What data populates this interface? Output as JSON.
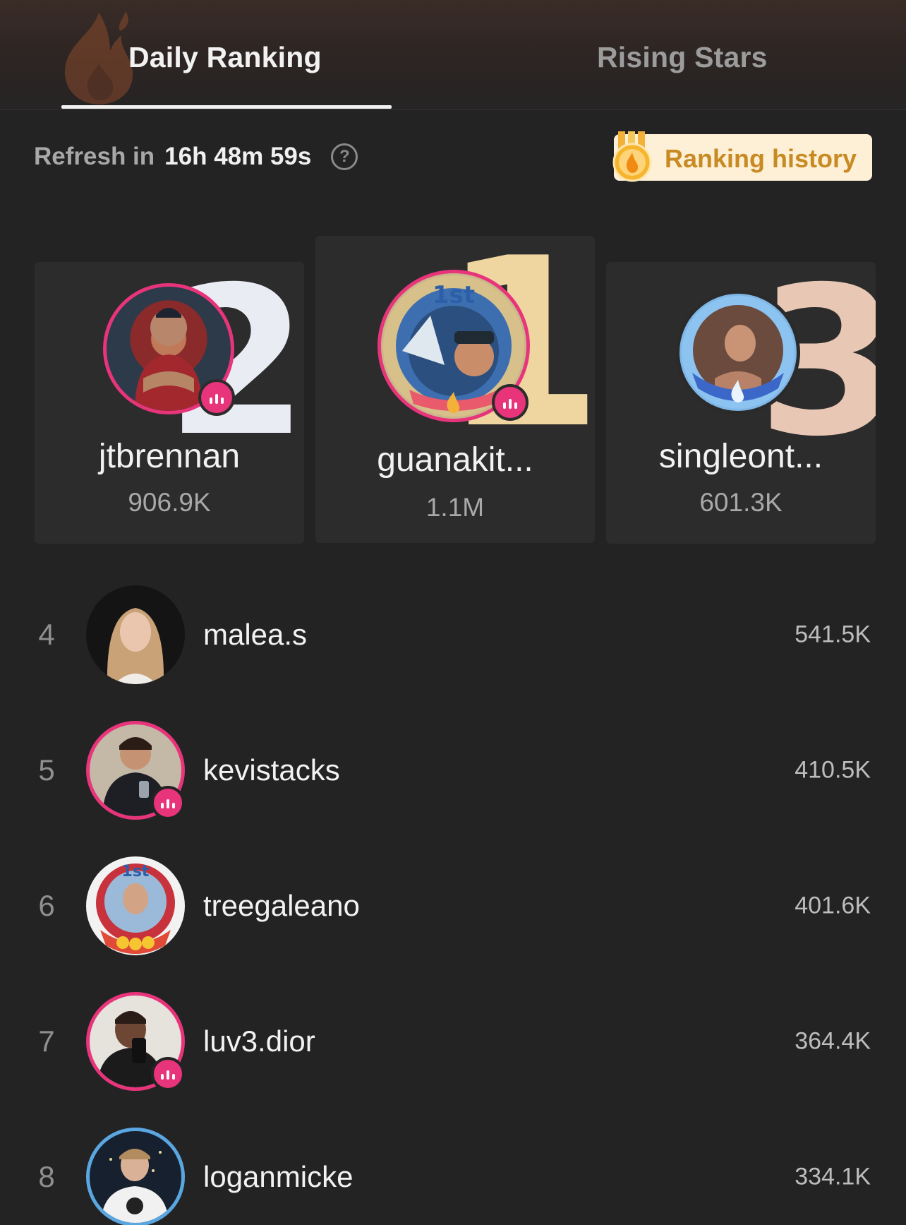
{
  "tabs": [
    {
      "label": "Daily Ranking",
      "active": true
    },
    {
      "label": "Rising Stars",
      "active": false
    }
  ],
  "refresh": {
    "label": "Refresh in",
    "time": "16h 48m 59s",
    "help_icon": "question-circle-icon"
  },
  "history_button": {
    "label": "Ranking history",
    "icon": "flame-medal-icon"
  },
  "podium": [
    {
      "rank": "2",
      "name": "jtbrennan",
      "score": "906.9K",
      "live": true
    },
    {
      "rank": "1",
      "name": "guanakit...",
      "score": "1.1M",
      "live": true
    },
    {
      "rank": "3",
      "name": "singleont...",
      "score": "601.3K",
      "live": false
    }
  ],
  "list": [
    {
      "rank": "4",
      "name": "malea.s",
      "score": "541.5K",
      "live": false
    },
    {
      "rank": "5",
      "name": "kevistacks",
      "score": "410.5K",
      "live": true
    },
    {
      "rank": "6",
      "name": "treegaleano",
      "score": "401.6K",
      "live": false
    },
    {
      "rank": "7",
      "name": "luv3.dior",
      "score": "364.4K",
      "live": true
    },
    {
      "rank": "8",
      "name": "loganmicke",
      "score": "334.1K",
      "live": false
    }
  ],
  "colors": {
    "background": "#232323",
    "live_pink": "#e8347a",
    "gold": "#efd5a0",
    "history_bg": "#fdf0d6",
    "history_text": "#c88a23",
    "avatar_ring_blue": "#5aa6e0"
  }
}
